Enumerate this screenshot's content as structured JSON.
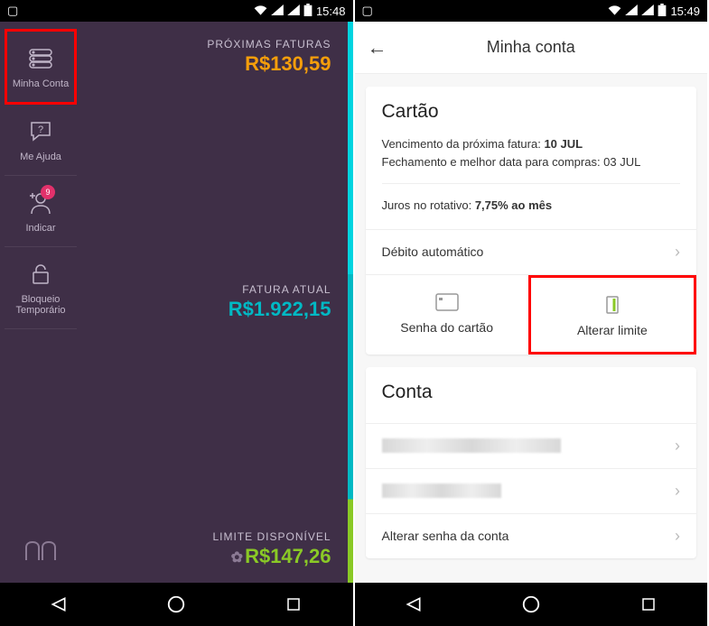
{
  "left": {
    "status": {
      "time": "15:48"
    },
    "sidebar": {
      "items": [
        {
          "label": "Minha Conta"
        },
        {
          "label": "Me Ajuda"
        },
        {
          "label": "Indicar",
          "badge": "9"
        },
        {
          "label": "Bloqueio Temporário"
        }
      ]
    },
    "blocks": {
      "upcoming": {
        "label": "PRÓXIMAS FATURAS",
        "value": "R$130,59"
      },
      "current": {
        "label": "FATURA ATUAL",
        "value": "R$1.922,15"
      },
      "available": {
        "label": "LIMITE DISPONÍVEL",
        "value": "R$147,26"
      }
    }
  },
  "right": {
    "status": {
      "time": "15:49"
    },
    "header": {
      "title": "Minha conta"
    },
    "card_section": {
      "title": "Cartão",
      "due_label": "Vencimento da próxima fatura: ",
      "due_value": "10 JUL",
      "close_label": "Fechamento e melhor data para compras: 03 JUL",
      "interest_label": "Juros no rotativo: ",
      "interest_value": "7,75% ao mês",
      "autodebit": "Débito automático",
      "actions": {
        "password": "Senha do cartão",
        "limit": "Alterar limite"
      }
    },
    "account_section": {
      "title": "Conta",
      "change_password": "Alterar senha da conta"
    }
  }
}
